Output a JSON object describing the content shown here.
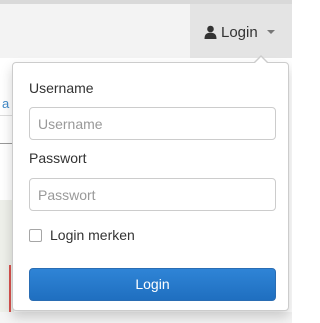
{
  "navbar": {
    "login_label": "Login",
    "user_icon": "user-icon",
    "caret_icon": "caret-down-icon"
  },
  "background": {
    "link_fragment": "a"
  },
  "login_form": {
    "username_label": "Username",
    "username_value": "",
    "username_placeholder": "Username",
    "password_label": "Passwort",
    "password_value": "",
    "password_placeholder": "Passwort",
    "remember_label": "Login merken",
    "remember_checked": false,
    "submit_label": "Login"
  },
  "colors": {
    "primary_button": "#1f6fc0",
    "link": "#428bca"
  }
}
